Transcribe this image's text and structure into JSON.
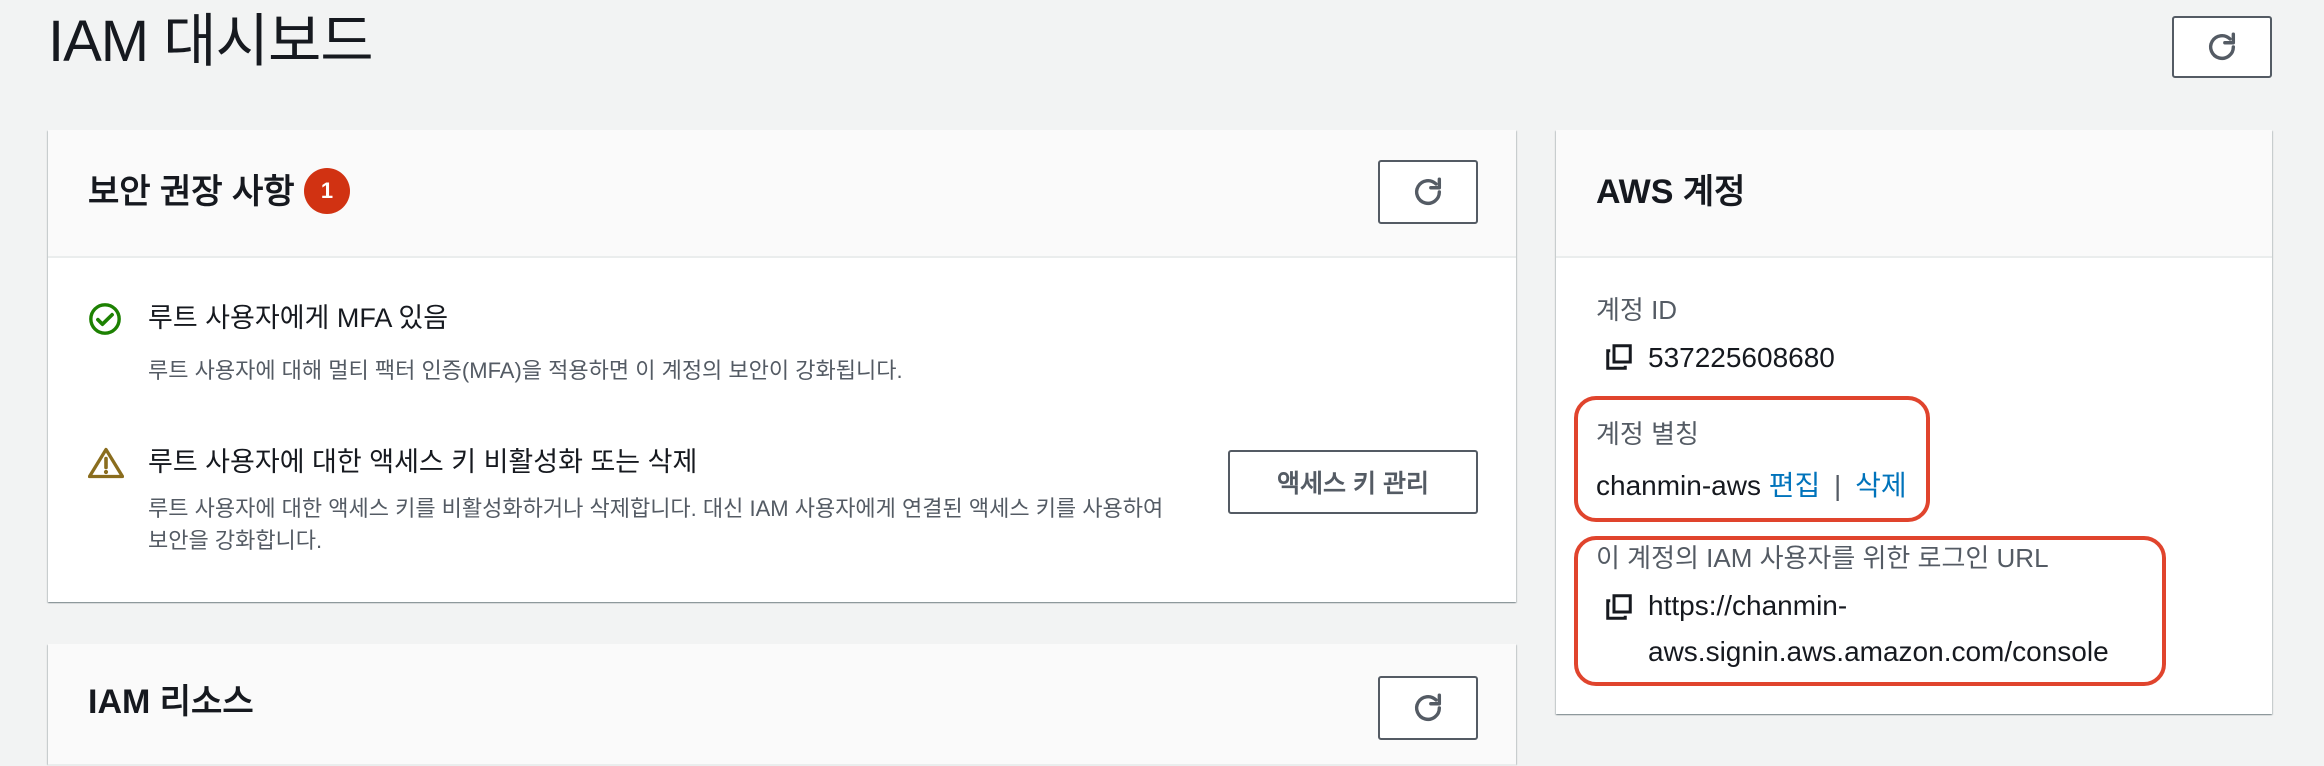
{
  "page": {
    "title": "IAM 대시보드"
  },
  "security": {
    "title": "보안 권장 사항",
    "badge_count": "1",
    "items": [
      {
        "title": "루트 사용자에게 MFA 있음",
        "description": "루트 사용자에 대해 멀티 팩터 인증(MFA)을 적용하면 이 계정의 보안이 강화됩니다.",
        "status": "success"
      },
      {
        "title": "루트 사용자에 대한 액세스 키 비활성화 또는 삭제",
        "description_line1": "루트 사용자에 대한 액세스 키를 비활성화하거나 삭제합니다. 대신 IAM 사용자에게 연결된 액세스 키를 사용하여",
        "description_line2": "보안을 강화합니다.",
        "status": "warning",
        "button_label": "액세스 키 관리"
      }
    ]
  },
  "resources": {
    "title": "IAM 리소스"
  },
  "account": {
    "title": "AWS 계정",
    "id_label": "계정 ID",
    "id_value": "537225608680",
    "alias_label": "계정 별칭",
    "alias_value": "chanmin-aws",
    "alias_edit": "편집",
    "alias_separator": "|",
    "alias_delete": "삭제",
    "signin_label": "이 계정의 IAM 사용자를 위한 로그인 URL",
    "signin_url_line1": "https://chanmin-",
    "signin_url_line2": "aws.signin.aws.amazon.com/console"
  },
  "colors": {
    "accent_link": "#0073bb",
    "badge": "#d13212",
    "success": "#1d8102",
    "warning": "#8a6d1e",
    "highlight": "#e0442d"
  },
  "icons": [
    "refresh-icon",
    "success-check-icon",
    "warning-icon",
    "copy-icon"
  ]
}
